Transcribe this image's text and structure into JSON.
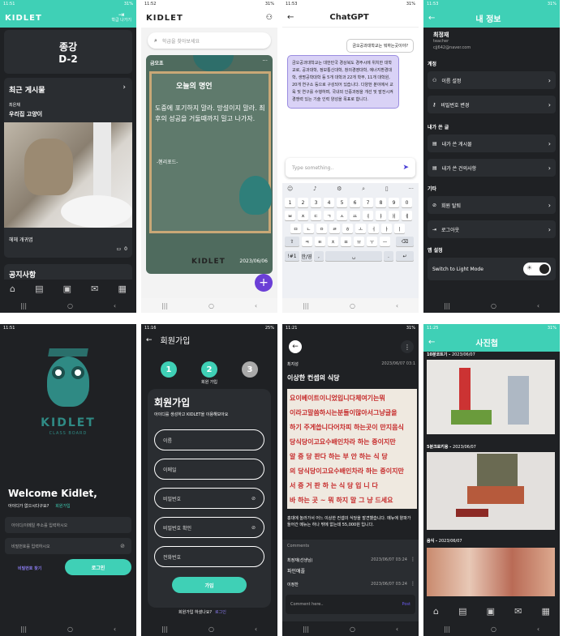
{
  "home": {
    "time": "11:51",
    "battery": "31%",
    "logo": "KIDLET",
    "logout": "학급 나가기",
    "dday_label": "종강",
    "dday_value": "D-2",
    "recent_title": "최근 게시물",
    "author": "최은채",
    "post_title": "우리집 고양이",
    "caption": "헤헤 개귀엽",
    "comments": "0",
    "next_title": "공지사항"
  },
  "board": {
    "time": "11:52",
    "battery": "31%",
    "logo": "KIDLET",
    "search_placeholder": "학급을 찾아보세요",
    "author": "금오초",
    "quote_title": "오늘의  명언",
    "quote_text": "도중에 포기하지 말라. 망설이지 말라. 최후의 성공을 거둘때까지 밀고 나가자.",
    "quote_author": "-헨리포드-",
    "brand": "KIDLET",
    "date": "2023/06/06",
    "more": "···",
    "fab": "+"
  },
  "chat": {
    "time": "11:53",
    "battery": "31%",
    "title": "ChatGPT",
    "user_msg": "금오공과대학교는 뭐하는곳이야?",
    "bot_msg": "금오공과대학교는 대한민국 경상북도 경주시에 위치한 대학교로, 공과대학, 정보통신대학, 창의경영대학, 에너지환경대학, 생명공학대학 등 5개 대학과 22개 학부, 11개 대학원, 20개 연구소 등으로 구성되어 있습니다. 다양한 분야에서 교육 및 연구를 수행하며, 국내외 인증과정을 개선 및 발전시켜 경쟁력 있는 기술 인력 양성을 목표로 합니다.",
    "placeholder": "Type something..",
    "keys_num": [
      "1",
      "2",
      "3",
      "4",
      "5",
      "6",
      "7",
      "8",
      "9",
      "0"
    ],
    "keys_r1": [
      "ㅂ",
      "ㅈ",
      "ㄷ",
      "ㄱ",
      "ㅅ",
      "ㅛ",
      "ㅕ",
      "ㅑ",
      "ㅐ",
      "ㅔ"
    ],
    "keys_r2": [
      "ㅁ",
      "ㄴ",
      "ㅇ",
      "ㄹ",
      "ㅎ",
      "ㅗ",
      "ㅓ",
      "ㅏ",
      "ㅣ"
    ],
    "keys_r3": [
      "ㅋ",
      "ㅌ",
      "ㅊ",
      "ㅍ",
      "ㅠ",
      "ㅜ",
      "ㅡ"
    ],
    "key_sym": "!#1",
    "key_lang": "한/영",
    "key_comma": ",",
    "key_dot": "."
  },
  "profile": {
    "time": "11:53",
    "battery": "31%",
    "title": "내 정보",
    "name": "최정재",
    "role": "teacher",
    "email": "cjj642@naver.com",
    "sec_account": "계정",
    "name_set": "이름 설정",
    "pw_change": "비밀번호 변경",
    "sec_posts": "내가 쓴 글",
    "my_posts": "내가 쓴 게시물",
    "my_suggest": "내가 쓴 건의사항",
    "sec_etc": "기타",
    "withdraw": "회원 탈퇴",
    "logout": "로그아웃",
    "sec_app": "앱 설정",
    "light_mode": "Switch to Light Mode"
  },
  "login": {
    "time": "11:51",
    "logo": "KIDLET",
    "sub": "CLASS BOARD",
    "welcome": "Welcome Kidlet,",
    "no_account": "아이디가 없으시다구요?",
    "signup_link": "회원가입",
    "id_placeholder": "아이디/이메일 주소를 입력하시오",
    "pw_placeholder": "비밀번호를 입력하시오",
    "find_pw": "비밀번호 찾기",
    "login_btn": "로그인"
  },
  "signup": {
    "time": "11:16",
    "battery": "25%",
    "title": "회원가입",
    "step1": "1",
    "step2": "2",
    "step3": "3",
    "step_label": "회원 가입",
    "heading": "회원가입",
    "desc": "아이디를 생성하고 KIDLET을 이용해보아요",
    "f_name": "이름",
    "f_email": "이메일",
    "f_pw": "비밀번호",
    "f_pw2": "비밀번호 확인",
    "f_phone": "전화번호",
    "btn": "가입",
    "has_account": "회원가입 하셨나요?",
    "login_link": "로그인"
  },
  "post": {
    "time": "11:21",
    "battery": "31%",
    "author": "최지성",
    "date": "2023/06/07 03:1",
    "title": "이상한 컨셉의 식당",
    "sign_lines": [
      "요이베이트이니었입니다체여기는뭐",
      "이라고말씀하시는분들이많아서그냥글을",
      "하기 주게씁니다어차피 하는곳이 만지음식",
      "당식당이고요수배인차라 하는 중이지만",
      "알 중 당 판다 하는 부 안 하는 식 당",
      "의 당식당이고요수배인차라 하는 중이지만",
      "서 중 거 판 하 는 식 당 입 니 다",
      "바 하는 곳 ~ 뭐 하지 말 그 냥 드세요"
    ],
    "body": "홍대에 놀러가서 어느 이상한 컨셉의 식당을 발견했습니다. 메뉴에 양파가 들어간 메뉴는 하나 밖에 없는데 55,000원 입니다.",
    "comments_label": "Comments",
    "c1_author": "최정재(선생님)",
    "c1_date": "2023/06/07 03:24",
    "c1_text": "파인애플",
    "c2_author": "이정찬",
    "c2_date": "2023/06/07 03:24",
    "comment_placeholder": "Comment here..",
    "post_btn": "Post"
  },
  "gallery": {
    "time": "11:25",
    "battery": "31%",
    "title": "사진첩",
    "items": [
      {
        "label": "10분코트기 -",
        "date": "2023/06/07"
      },
      {
        "label": "5분크로키용 -",
        "date": "2023/06/07"
      },
      {
        "label": "음식 -",
        "date": "2023/06/07"
      }
    ]
  },
  "colors": {
    "accent": "#3fd0b6",
    "dark": "#1f2124"
  }
}
